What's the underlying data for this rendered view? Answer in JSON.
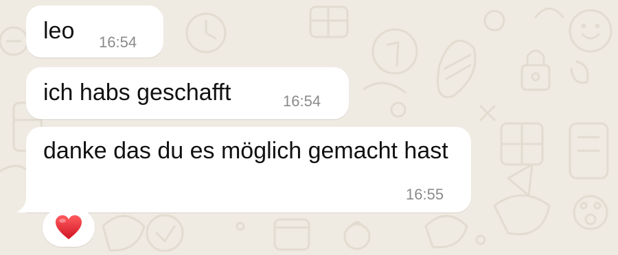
{
  "chat": {
    "background_color": "#efeae2",
    "bubble_color": "#ffffff",
    "messages": [
      {
        "text": "leo",
        "time": "16:54"
      },
      {
        "text": "ich habs geschafft",
        "time": "16:54"
      },
      {
        "text": "danke das du es möglich gemacht hast",
        "time": "16:55"
      }
    ],
    "reaction": {
      "icon": "red-heart-icon",
      "color": "#e0242c"
    }
  }
}
